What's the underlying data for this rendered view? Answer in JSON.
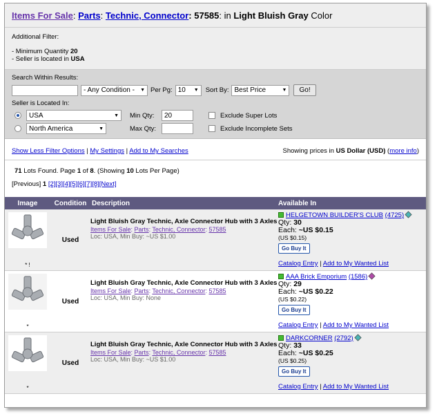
{
  "title": {
    "items_for_sale": "Items For Sale",
    "sep1": ":",
    "parts": "Parts",
    "sep2": ":",
    "category": "Technic, Connector",
    "part_suffix": ": 57585",
    "in_text": ": in",
    "color_name": "Light Bluish Gray",
    "color_word": "Color"
  },
  "additional_filter": {
    "label": "Additional Filter:",
    "min_qty_text": "- Minimum Quantity",
    "min_qty_value": "20",
    "seller_text": "- Seller is located in",
    "seller_value": "USA"
  },
  "search": {
    "within_label": "Search Within Results:",
    "condition_value": "- Any Condition -",
    "perpg_label": "Per Pg:",
    "perpg_value": "10",
    "sortby_label": "Sort By:",
    "sortby_value": "Best Price",
    "go_label": "Go!",
    "seller_located_label": "Seller is Located In:",
    "country_value": "USA",
    "region_value": "North America",
    "minqty_label": "Min Qty:",
    "minqty_value": "20",
    "maxqty_label": "Max Qty:",
    "maxqty_value": "",
    "exclude_super": "Exclude Super Lots",
    "exclude_incomplete": "Exclude Incomplete Sets"
  },
  "links": {
    "show_less": "Show Less Filter Options",
    "my_settings": "My Settings",
    "add_search": "Add to My Searches",
    "sep": "|",
    "prices_text": "Showing prices in",
    "currency": "US Dollar (USD)",
    "more_info": "more info"
  },
  "results": {
    "count": "71",
    "found_text": "Lots Found. Page",
    "page": "1",
    "of_text": "of",
    "pages": "8",
    "showing_text": "(Showing",
    "per_page": "10",
    "per_page_text": "Lots Per Page)"
  },
  "pager": {
    "previous": "[Previous]",
    "current": "1",
    "pages": [
      "[2]",
      "[3]",
      "[4]",
      "[5]",
      "[6]",
      "[7]",
      "[8]"
    ],
    "next": "[Next]"
  },
  "table_headers": {
    "image": "Image",
    "condition": "Condition",
    "description": "Description",
    "available": "Available In"
  },
  "listings": [
    {
      "stars": "* !",
      "condition": "Used",
      "title": "Light Bluish Gray Technic, Axle Connector Hub with 3 Axles",
      "crumb_items": "Items For Sale",
      "crumb_parts": "Parts",
      "crumb_cat": "Technic, Connector",
      "crumb_num": "57585",
      "loc": "Loc: USA, Min Buy: ~US $1.00",
      "store": "HELGETOWN BUILDER'S CLUB",
      "feedback": "(4725)",
      "qty_label": "Qty:",
      "qty": "30",
      "each_label": "Each:",
      "price": "~US $0.15",
      "orig": "(US $0.15)",
      "buy": "Go Buy It",
      "catalog": "Catalog Entry",
      "wanted": "Add to My Wanted List",
      "cube_color": "#4ab5b5"
    },
    {
      "stars": "*",
      "condition": "Used",
      "title": "Light Bluish Gray Technic, Axle Connector Hub with 3 Axles",
      "crumb_items": "Items For Sale",
      "crumb_parts": "Parts",
      "crumb_cat": "Technic, Connector",
      "crumb_num": "57585",
      "loc": "Loc: USA, Min Buy: None",
      "store": "AAA Brick Emporium",
      "feedback": "(1586)",
      "qty_label": "Qty:",
      "qty": "29",
      "each_label": "Each:",
      "price": "~US $0.22",
      "orig": "(US $0.22)",
      "buy": "Go Buy It",
      "catalog": "Catalog Entry",
      "wanted": "Add to My Wanted List",
      "cube_color": "#b04aa8"
    },
    {
      "stars": "*",
      "condition": "Used",
      "title": "Light Bluish Gray Technic, Axle Connector Hub with 3 Axles",
      "crumb_items": "Items For Sale",
      "crumb_parts": "Parts",
      "crumb_cat": "Technic, Connector",
      "crumb_num": "57585",
      "loc": "Loc: USA, Min Buy: ~US $1.00",
      "store": "DARKCORNER",
      "feedback": "(2792)",
      "qty_label": "Qty:",
      "qty": "33",
      "each_label": "Each:",
      "price": "~US $0.25",
      "orig": "(US $0.25)",
      "buy": "Go Buy It",
      "catalog": "Catalog Entry",
      "wanted": "Add to My Wanted List",
      "cube_color": "#4ab5b5"
    }
  ],
  "colors": {
    "header_bar": "#5e5a80",
    "link": "#0000cc",
    "visited": "#6633aa",
    "filter_bg": "#d6d6d6"
  }
}
